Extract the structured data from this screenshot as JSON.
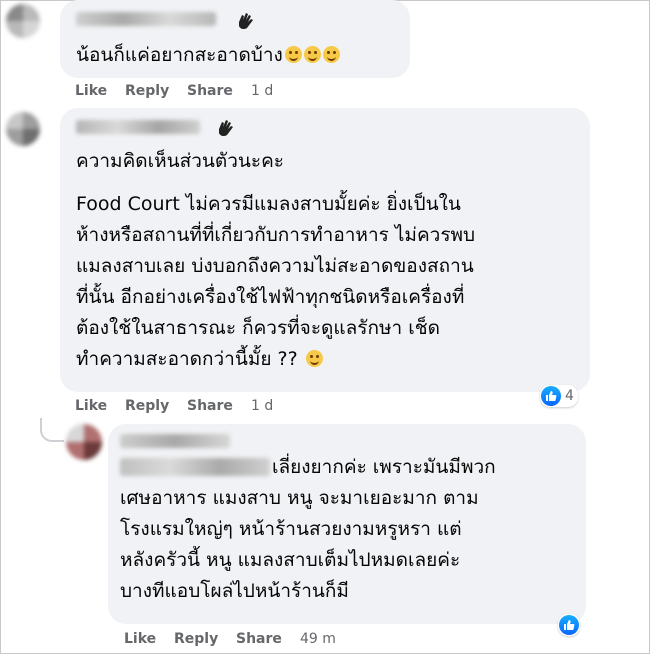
{
  "comments": [
    {
      "text_lines": [
        "น้อนก็แค่อยากสะอาดบ้าง"
      ],
      "emoji": [
        "grinning-sweat-emoji",
        "grinning-sweat-emoji",
        "grinning-sweat-emoji"
      ],
      "actions": {
        "like": "Like",
        "reply": "Reply",
        "share": "Share",
        "time": "1 d"
      }
    },
    {
      "text_lines": [
        "ความคิดเห็นส่วนตัวนะคะ",
        "",
        "Food Court ไม่ควรมีแมลงสาบมั้ยค่ะ ยิ่งเป็นใน",
        "ห้างหรือสถานที่ที่เกี่ยวกับการทำอาหาร ไม่ควรพบ",
        "แมลงสาบเลย บ่งบอกถึงความไม่สะอาดของสถาน",
        "ที่นั้น อีกอย่างเครื่องใช้ไฟฟ้าทุกชนิดหรือเครื่องที่",
        "ต้องใช้ในสาธารณะ ก็ควรที่จะดูแลรักษา เช็ด",
        "ทำความสะอาดกว่านี้มั้ย ??"
      ],
      "actions": {
        "like": "Like",
        "reply": "Reply",
        "share": "Share",
        "time": "1 d"
      },
      "reaction_count": "4"
    },
    {
      "text_lines": [
        "เลี่ยงยากค่ะ เพราะมันมีพวก",
        "เศษอาหาร แมงสาบ หนู จะมาเยอะมาก ตาม",
        "โรงแรมใหญ่ๆ หน้าร้านสวยงามหรูหรา แต่",
        "หลังครัวนี้ หนู แมลงสาบเต็มไปหมดเลยค่ะ",
        "บางทีแอบโผล่ไปหน้าร้านก็มี"
      ],
      "actions": {
        "like": "Like",
        "reply": "Reply",
        "share": "Share",
        "time": "49 m"
      }
    }
  ],
  "colors": {
    "bubble": "#f0f2f5",
    "meta": "#65676b",
    "like_blue": "#0866ff"
  }
}
